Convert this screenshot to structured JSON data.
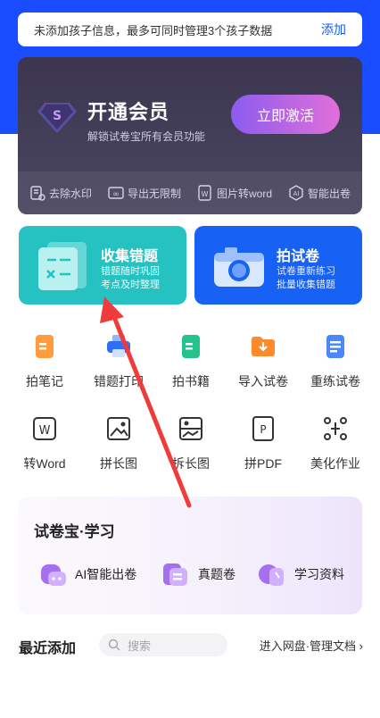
{
  "notice": {
    "text": "未添加孩子信息，最多可同时管理3个孩子数据",
    "action": "添加"
  },
  "vip": {
    "title": "开通会员",
    "subtitle": "解锁试卷宝所有会员功能",
    "button": "立即激活",
    "features": [
      "去除水印",
      "导出无限制",
      "图片转word",
      "智能出卷"
    ]
  },
  "cards": [
    {
      "title": "收集错题",
      "desc1": "错题随时巩固",
      "desc2": "考点及时整理"
    },
    {
      "title": "拍试卷",
      "desc1": "试卷重新练习",
      "desc2": "批量收集错题"
    }
  ],
  "tools_row1": [
    "拍笔记",
    "错题打印",
    "拍书籍",
    "导入试卷",
    "重练试卷"
  ],
  "tools_row2": [
    "转Word",
    "拼长图",
    "拆长图",
    "拼PDF",
    "美化作业"
  ],
  "study": {
    "title": "试卷宝·学习",
    "items": [
      "AI智能出卷",
      "真题卷",
      "学习资料"
    ]
  },
  "recent": {
    "title": "最近添加",
    "search_placeholder": "搜索",
    "link": "进入网盘·管理文档 ›"
  },
  "colors": {
    "brand_blue": "#1a4dff",
    "teal": "#26c2c2",
    "vip_dark": "#3b3550"
  }
}
